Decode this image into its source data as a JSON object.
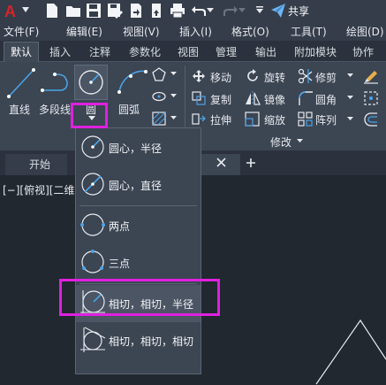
{
  "qat": {
    "share_label": "共享"
  },
  "menu": [
    "文件(F)",
    "编辑(E)",
    "视图(V)",
    "插入(I)",
    "格式(O)",
    "工具(T)",
    "绘图(D)"
  ],
  "ribbon_tabs": [
    "默认",
    "插入",
    "注释",
    "参数化",
    "视图",
    "管理",
    "输出",
    "附加模块",
    "协作"
  ],
  "draw_tools": {
    "line": "直线",
    "polyline": "多段线",
    "circle": "圆",
    "arc": "圆弧"
  },
  "modify_tools": {
    "move": "移动",
    "rotate": "旋转",
    "trim": "修剪",
    "copy": "复制",
    "mirror": "镜像",
    "fillet": "圆角",
    "stretch": "拉伸",
    "scale": "缩放",
    "array": "阵列",
    "panel_title": "修改"
  },
  "doc_tabs": {
    "start": "开始"
  },
  "viewport": {
    "label": "[−][俯视][二维"
  },
  "circle_menu": [
    "圆心，半径",
    "圆心，直径",
    "两点",
    "三点",
    "相切，相切，半径",
    "相切，相切，相切"
  ],
  "colors": {
    "highlight": "#e020e0",
    "accent_blue": "#4aa3e8",
    "background": "#212830",
    "panel": "#3c4552"
  }
}
